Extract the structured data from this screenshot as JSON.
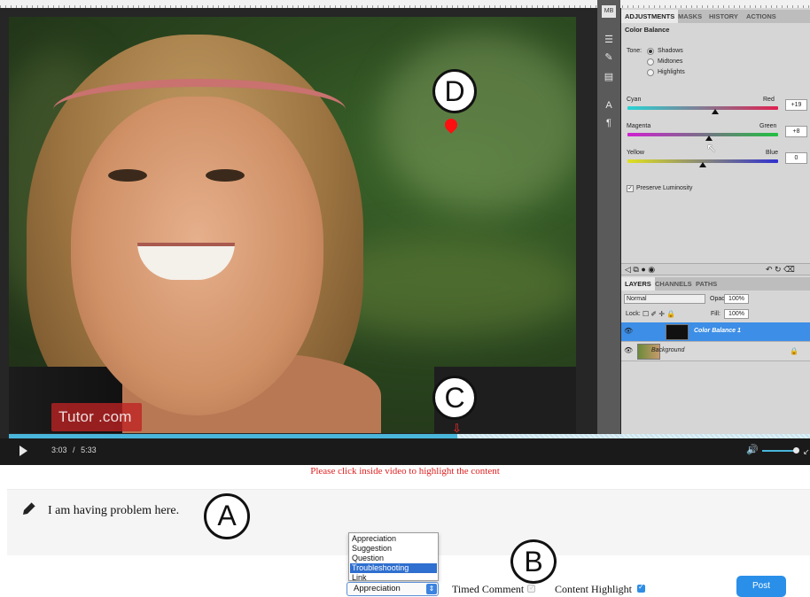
{
  "video": {
    "watermark": "Tutor .com",
    "time_current": "3:03",
    "time_sep": "/",
    "time_total": "5:33",
    "progress_fraction": 0.56,
    "volume_fraction": 0.9
  },
  "photoshop": {
    "tabs": [
      "ADJUSTMENTS",
      "MASKS",
      "HISTORY",
      "ACTIONS"
    ],
    "panel_title": "Color Balance",
    "tone_label": "Tone:",
    "tones": [
      "Shadows",
      "Midtones",
      "Highlights"
    ],
    "selected_tone": "Shadows",
    "sliders": [
      {
        "left": "Cyan",
        "right": "Red",
        "value": "+19"
      },
      {
        "left": "Magenta",
        "right": "Green",
        "value": "+8"
      },
      {
        "left": "Yellow",
        "right": "Blue",
        "value": "0"
      }
    ],
    "preserve_label": "Preserve Luminosity",
    "layers_tabs": [
      "LAYERS",
      "CHANNELS",
      "PATHS"
    ],
    "blend_mode": "Normal",
    "opacity_label": "Opacity:",
    "opacity_value": "100%",
    "lock_label": "Lock:",
    "fill_label": "Fill:",
    "fill_value": "100%",
    "layers": [
      "Color Balance 1",
      "Background"
    ]
  },
  "markers": {
    "label_a": "A",
    "label_b": "B",
    "label_c": "C",
    "label_d": "D"
  },
  "hint": "Please click inside video to highlight the content",
  "comment": {
    "text": "I am having problem here."
  },
  "category": {
    "options": [
      "Appreciation",
      "Suggestion",
      "Question",
      "Troubleshooting",
      "Link"
    ],
    "highlighted": "Troubleshooting",
    "selected": "Appreciation"
  },
  "options": {
    "timed_comment_label": "Timed Comment",
    "timed_comment_checked": false,
    "content_highlight_label": "Content Highlight",
    "content_highlight_checked": true
  },
  "post_label": "Post",
  "colors": {
    "accent": "#2a8fe8",
    "progress": "#4ab6db",
    "marker": "#ff1010",
    "hint": "#e02020"
  }
}
